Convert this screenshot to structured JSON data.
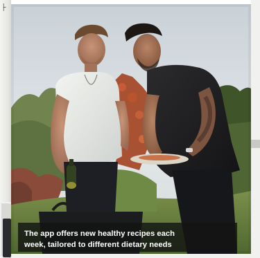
{
  "caption": {
    "line1": "The app offers new healthy recipes each",
    "line2": "week, tailored to different dietary needs"
  },
  "photo": {
    "subject": "photo-two-men-cooking-in-garden"
  },
  "colors": {
    "sky": "#d7dde2",
    "foliage": "#5f7a3e",
    "white_shirt": "#e9ebe8",
    "black_shirt": "#1c1c1e",
    "caption_bg": "#121412",
    "caption_text": "#ffffff"
  }
}
